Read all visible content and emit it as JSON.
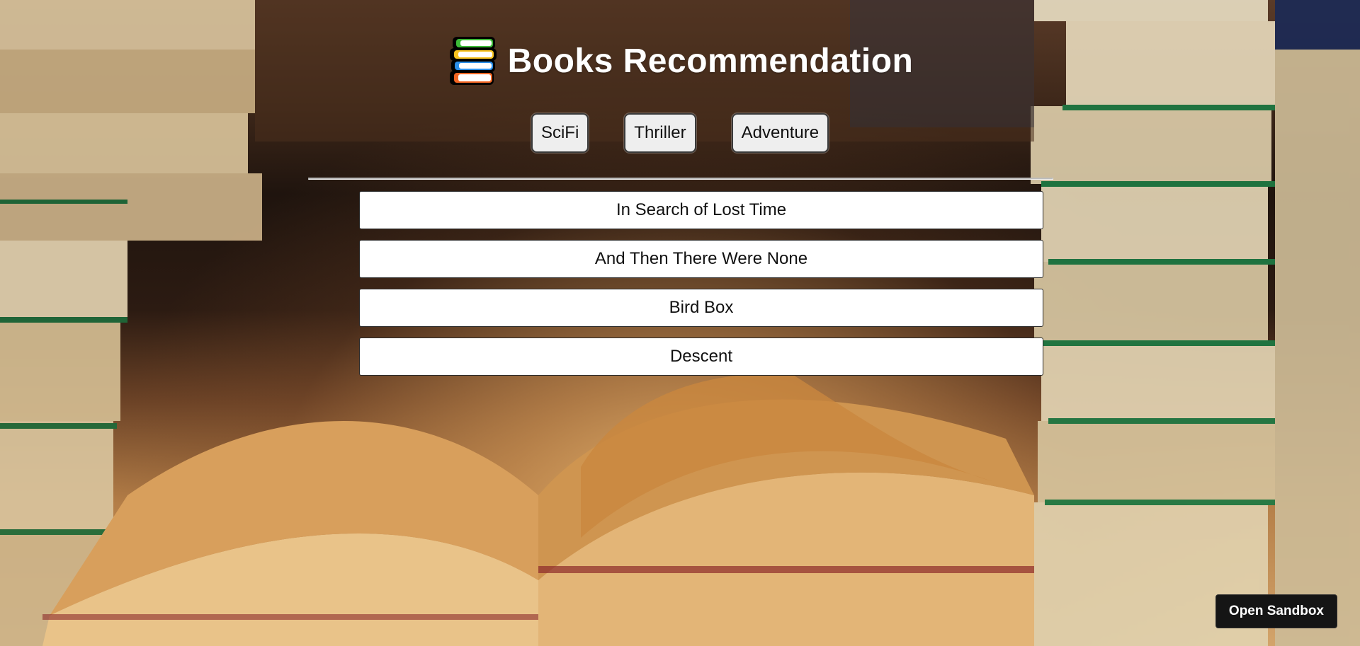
{
  "app": {
    "title": "Books Recommendation",
    "logo_icon": "books-stack-icon"
  },
  "genres": [
    {
      "label": "SciFi"
    },
    {
      "label": "Thriller"
    },
    {
      "label": "Adventure"
    }
  ],
  "books": [
    {
      "title": "In Search of Lost Time"
    },
    {
      "title": "And Then There Were None"
    },
    {
      "title": "Bird Box"
    },
    {
      "title": "Descent"
    }
  ],
  "sandbox": {
    "label": "Open Sandbox"
  },
  "colors": {
    "title_text": "#ffffff",
    "button_bg": "#eeeeee",
    "book_card_bg": "#ffffff",
    "sandbox_bg": "#151515"
  }
}
